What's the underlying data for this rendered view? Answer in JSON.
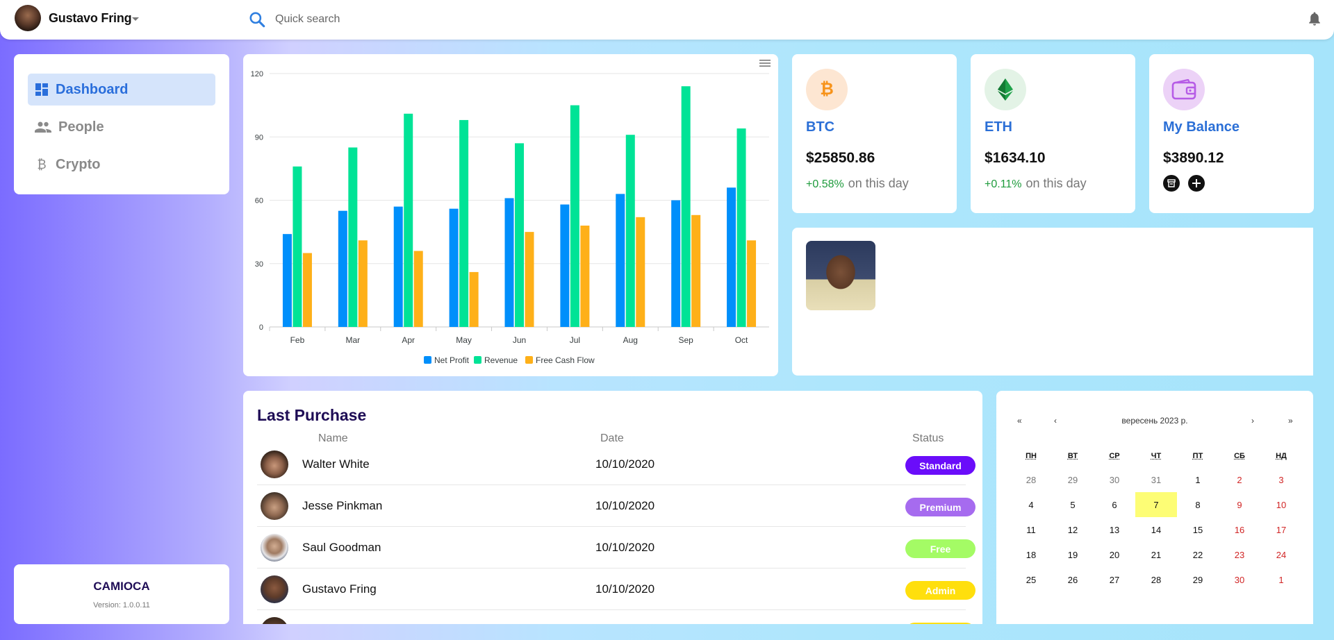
{
  "header": {
    "user_name": "Gustavo Fring",
    "search_placeholder": "Quick search"
  },
  "sidebar": {
    "items": [
      {
        "label": "Dashboard",
        "icon": "dashboard-icon",
        "active": true
      },
      {
        "label": "People",
        "icon": "people-icon",
        "active": false
      },
      {
        "label": "Crypto",
        "icon": "bitcoin-icon",
        "active": false
      }
    ]
  },
  "footer": {
    "brand": "CAMIOCA",
    "version": "Version: 1.0.0.11"
  },
  "chart_data": {
    "type": "bar",
    "categories": [
      "Feb",
      "Mar",
      "Apr",
      "May",
      "Jun",
      "Jul",
      "Aug",
      "Sep",
      "Oct"
    ],
    "series": [
      {
        "name": "Net Profit",
        "color": "#008ffb",
        "values": [
          44,
          55,
          57,
          56,
          61,
          58,
          63,
          60,
          66
        ]
      },
      {
        "name": "Revenue",
        "color": "#00e396",
        "values": [
          76,
          85,
          101,
          98,
          87,
          105,
          91,
          114,
          94
        ]
      },
      {
        "name": "Free Cash Flow",
        "color": "#feb019",
        "values": [
          35,
          41,
          36,
          26,
          45,
          48,
          52,
          53,
          41
        ]
      }
    ],
    "y_ticks": [
      0,
      30,
      60,
      90,
      120
    ],
    "ylim": [
      0,
      120
    ],
    "grid": true,
    "legend": "bottom-center"
  },
  "coins": [
    {
      "name": "BTC",
      "price": "$25850.86",
      "change": "+0.58%",
      "change_label": "on this day",
      "icon": "bitcoin-icon",
      "accent": "#f7931a",
      "bg": "#fde6d2"
    },
    {
      "name": "ETH",
      "price": "$1634.10",
      "change": "+0.11%",
      "change_label": "on this day",
      "icon": "ethereum-icon",
      "accent": "#1fa24a",
      "bg": "#e3f3e6"
    }
  ],
  "balance": {
    "title": "My Balance",
    "amount": "$3890.12",
    "icon": "wallet-icon",
    "accent": "#b65ce6"
  },
  "purchases": {
    "title": "Last Purchase",
    "columns": [
      "Name",
      "Date",
      "Status"
    ],
    "rows": [
      {
        "name": "Walter White",
        "date": "10/10/2020",
        "status": "Standard",
        "color": "#6a0dfa"
      },
      {
        "name": "Jesse Pinkman",
        "date": "10/10/2020",
        "status": "Premium",
        "color": "#a66bef"
      },
      {
        "name": "Saul Goodman",
        "date": "10/10/2020",
        "status": "Free",
        "color": "#a4fb65"
      },
      {
        "name": "Gustavo Fring",
        "date": "10/10/2020",
        "status": "Admin",
        "color": "#ffdf0d"
      },
      {
        "name": "",
        "date": "",
        "status": "",
        "color": "#ffdf0d"
      }
    ]
  },
  "calendar": {
    "prev2": "«",
    "prev": "‹",
    "month": "вересень 2023 р.",
    "next": "›",
    "next2": "»",
    "weekdays": [
      "ПН",
      "ВТ",
      "СР",
      "ЧТ",
      "ПТ",
      "СБ",
      "НД"
    ],
    "weeks": [
      [
        "28",
        "29",
        "30",
        "31",
        "1",
        "2",
        "3"
      ],
      [
        "4",
        "5",
        "6",
        "7",
        "8",
        "9",
        "10"
      ],
      [
        "11",
        "12",
        "13",
        "14",
        "15",
        "16",
        "17"
      ],
      [
        "18",
        "19",
        "20",
        "21",
        "22",
        "23",
        "24"
      ],
      [
        "25",
        "26",
        "27",
        "28",
        "29",
        "30",
        "1"
      ]
    ],
    "today": "7"
  }
}
